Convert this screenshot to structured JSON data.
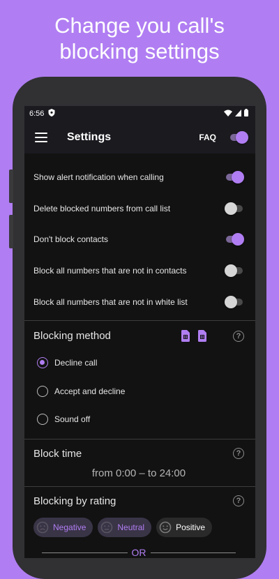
{
  "headline": [
    "Change you call's",
    "blocking settings"
  ],
  "colors": {
    "accent": "#b07ef2",
    "background": "#b07ef2",
    "screen": "#121212"
  },
  "status_bar": {
    "time": "6:56",
    "icons": [
      "shield-icon",
      "wifi-icon",
      "signal-icon",
      "battery-icon"
    ]
  },
  "app_bar": {
    "menu_icon": "menu-icon",
    "title": "Settings",
    "faq_label": "FAQ",
    "master_switch_on": true
  },
  "toggles": [
    {
      "label": "Show alert notification when calling",
      "on": true
    },
    {
      "label": "Delete blocked numbers from call list",
      "on": false
    },
    {
      "label": "Don't block contacts",
      "on": true
    },
    {
      "label": "Block all numbers that are not in contacts",
      "on": false
    },
    {
      "label": "Block all numbers that are not in white list",
      "on": false
    }
  ],
  "blocking_method": {
    "title": "Blocking method",
    "icons": [
      "sim1-icon",
      "sim2-icon",
      "help-icon"
    ],
    "options": [
      {
        "label": "Decline call",
        "selected": true
      },
      {
        "label": "Accept and decline",
        "selected": false
      },
      {
        "label": "Sound off",
        "selected": false
      }
    ]
  },
  "block_time": {
    "title": "Block time",
    "range": "from 0:00 – to 24:00"
  },
  "blocking_by_rating": {
    "title": "Blocking by rating",
    "chips": [
      {
        "label": "Negative",
        "selected": true,
        "icon": "sad-face-icon"
      },
      {
        "label": "Neutral",
        "selected": true,
        "icon": "neutral-face-icon"
      },
      {
        "label": "Positive",
        "selected": false,
        "icon": "happy-face-icon"
      }
    ],
    "separator": "OR"
  },
  "help_glyph": "?"
}
